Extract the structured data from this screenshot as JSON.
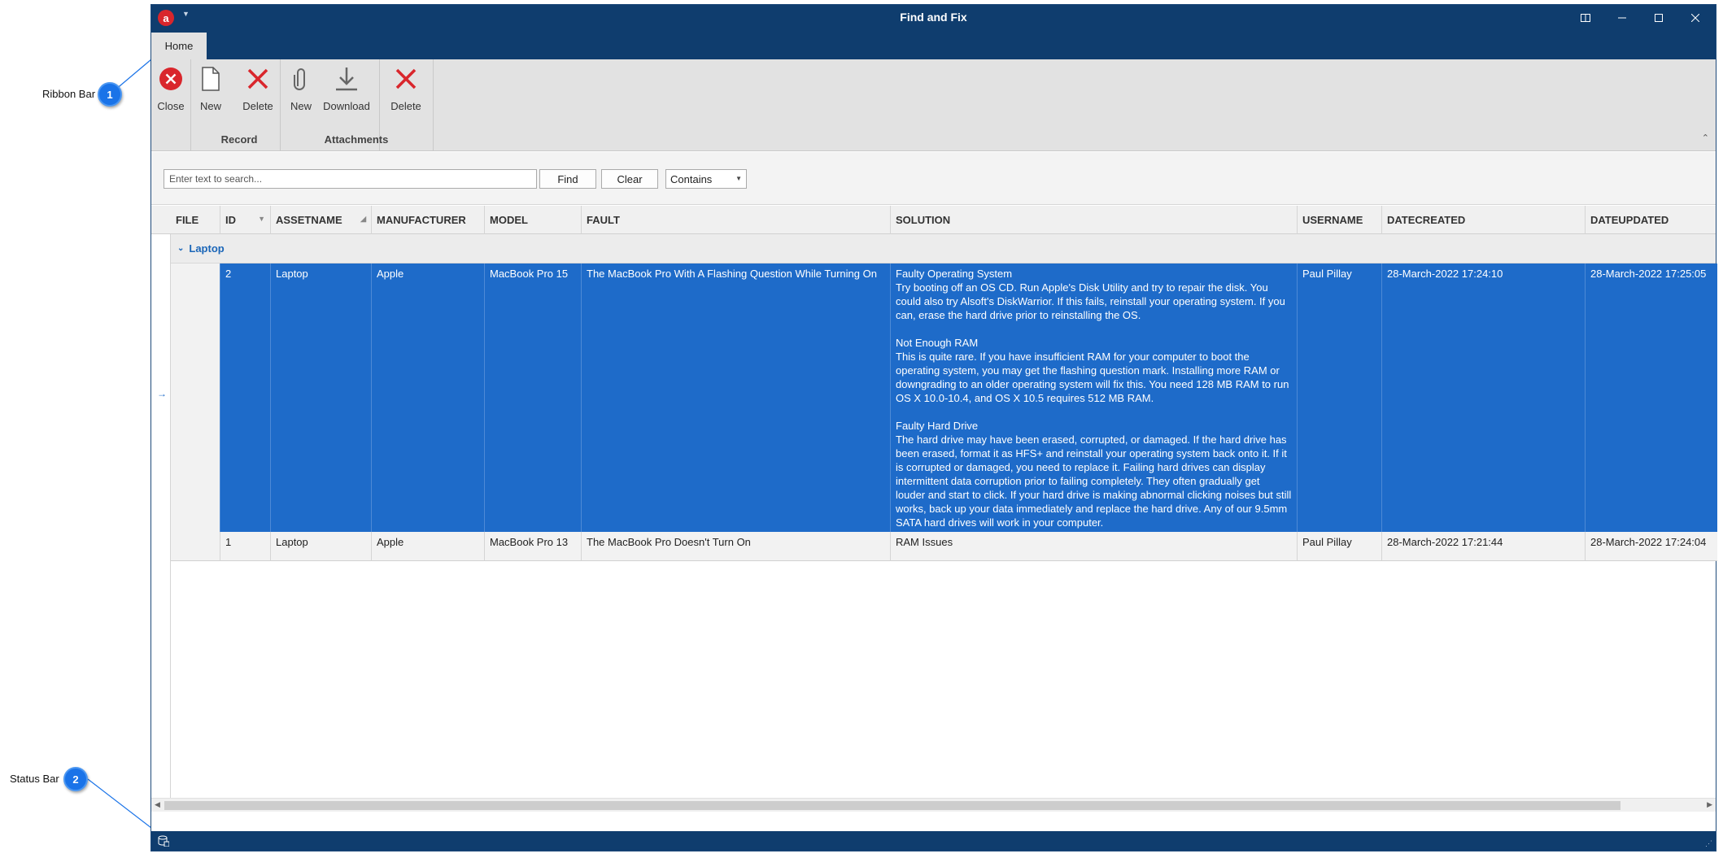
{
  "annotations": [
    {
      "number": "1",
      "label": "Ribbon Bar"
    },
    {
      "number": "2",
      "label": "Status Bar"
    }
  ],
  "window": {
    "title": "Find and Fix",
    "app_icon_letter": "a"
  },
  "tabs": [
    {
      "label": "Home"
    }
  ],
  "ribbon": {
    "buttons": [
      {
        "label": "Close",
        "icon": "close-circle-icon"
      },
      {
        "label": "New",
        "icon": "new-document-icon"
      },
      {
        "label": "Delete",
        "icon": "delete-x-icon"
      },
      {
        "label": "New",
        "icon": "paperclip-icon"
      },
      {
        "label": "Download",
        "icon": "download-icon"
      },
      {
        "label": "Delete",
        "icon": "delete-x-icon"
      }
    ],
    "groups": [
      {
        "label": "Record"
      },
      {
        "label": "Attachments"
      }
    ]
  },
  "search": {
    "placeholder": "Enter text to search...",
    "value": "",
    "find_label": "Find",
    "clear_label": "Clear",
    "mode": "Contains"
  },
  "grid": {
    "columns": [
      "FILE",
      "ID",
      "ASSETNAME",
      "MANUFACTURER",
      "MODEL",
      "FAULT",
      "SOLUTION",
      "USERNAME",
      "DATECREATED",
      "DATEUPDATED"
    ],
    "group_label": "Laptop",
    "rows": [
      {
        "file": "",
        "id": "2",
        "assetname": "Laptop",
        "manufacturer": "Apple",
        "model": "MacBook Pro 15",
        "fault": "The MacBook Pro With A Flashing Question While Turning On",
        "solution": "Faulty Operating System\nTry booting off an OS CD. Run Apple's Disk Utility and try to repair the disk. You could also try Alsoft's DiskWarrior. If this fails, reinstall your operating system. If you can, erase the hard drive prior to reinstalling the OS.\n\nNot Enough RAM\nThis is quite rare. If you have insufficient RAM for your computer to boot the operating system, you may get the flashing question mark. Installing more RAM or downgrading to an older operating system will fix this. You need 128 MB RAM to run OS X 10.0-10.4, and OS X 10.5 requires 512 MB RAM.\n\nFaulty Hard Drive\nThe hard drive may have been erased, corrupted, or damaged. If the hard drive has been erased, format it as HFS+ and reinstall your operating system back onto it. If it is corrupted or damaged, you need to replace it. Failing hard drives can display intermittent data corruption prior to failing completely. They often gradually get louder and start to click. If your hard drive is making abnormal clicking noises but still works, back up your data immediately and replace the hard drive. Any of our 9.5mm SATA hard drives will work in your computer.",
        "username": "Paul Pillay",
        "datecreated": "28-March-2022 17:24:10",
        "dateupdated": "28-March-2022 17:25:05",
        "selected": true
      },
      {
        "file": "",
        "id": "1",
        "assetname": "Laptop",
        "manufacturer": "Apple",
        "model": "MacBook Pro 13",
        "fault": "The MacBook Pro Doesn't Turn On",
        "solution": "RAM Issues",
        "username": "Paul Pillay",
        "datecreated": "28-March-2022 17:21:44",
        "dateupdated": "28-March-2022 17:24:04",
        "selected": false
      }
    ]
  },
  "colors": {
    "title_bar": "#0f3d6e",
    "selection": "#1e6bc9",
    "group_text": "#1b66b8",
    "delete_red": "#d9262c"
  }
}
